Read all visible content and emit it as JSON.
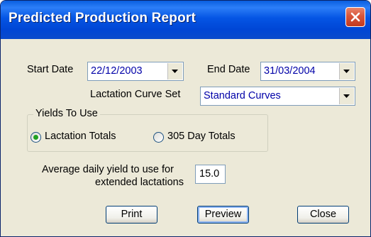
{
  "window": {
    "title": "Predicted Production Report"
  },
  "dates": {
    "start_label": "Start Date",
    "start_value": "22/12/2003",
    "end_label": "End Date",
    "end_value": "31/03/2004"
  },
  "curve": {
    "label": "Lactation Curve Set",
    "value": "Standard Curves"
  },
  "yields": {
    "group_title": "Yields To Use",
    "options": [
      {
        "label": "Lactation Totals",
        "selected": true
      },
      {
        "label": "305 Day Totals",
        "selected": false
      }
    ]
  },
  "average": {
    "label_line1": "Average daily yield to use for",
    "label_line2": "extended lactations",
    "value": "15.0"
  },
  "buttons": {
    "print": "Print",
    "preview": "Preview",
    "close": "Close"
  },
  "colors": {
    "titlebar": "#0a5fe0",
    "dialog_bg": "#ece9d8",
    "combo_text": "#0000a8",
    "close_button": "#d8553a",
    "radio_dot": "#21a121"
  },
  "icons": {
    "close": "close-icon",
    "dropdown": "chevron-down-icon"
  }
}
